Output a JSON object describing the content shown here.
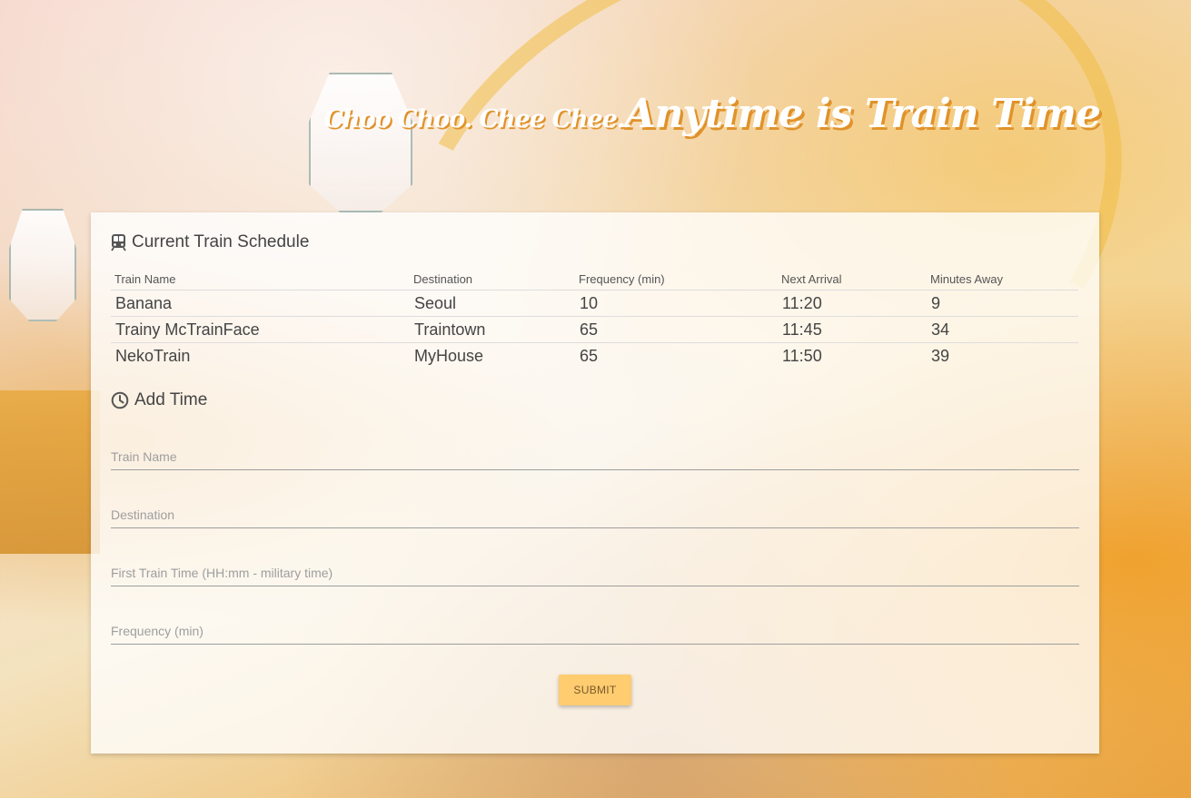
{
  "header": {
    "tagline": "Choo Choo. Chee Chee.",
    "title": "Anytime is Train Time"
  },
  "schedule": {
    "title": "Current Train Schedule",
    "icon": "train-icon",
    "columns": [
      "Train Name",
      "Destination",
      "Frequency (min)",
      "Next Arrival",
      "Minutes Away"
    ],
    "rows": [
      [
        "Banana",
        "Seoul",
        "10",
        "11:20",
        "9"
      ],
      [
        "Trainy McTrainFace",
        "Traintown",
        "65",
        "11:45",
        "34"
      ],
      [
        "NekoTrain",
        "MyHouse",
        "65",
        "11:50",
        "39"
      ]
    ]
  },
  "form": {
    "title": "Add Time",
    "icon": "clock-icon",
    "fields": {
      "train_name": {
        "placeholder": "Train Name",
        "value": ""
      },
      "destination": {
        "placeholder": "Destination",
        "value": ""
      },
      "first_time": {
        "placeholder": "First Train Time (HH:mm - military time)",
        "value": ""
      },
      "frequency": {
        "placeholder": "Frequency (min)",
        "value": ""
      }
    },
    "submit_label": "SUBMIT"
  },
  "colors": {
    "accent": "#ffcc70",
    "title_shadow": "#e0922a"
  }
}
